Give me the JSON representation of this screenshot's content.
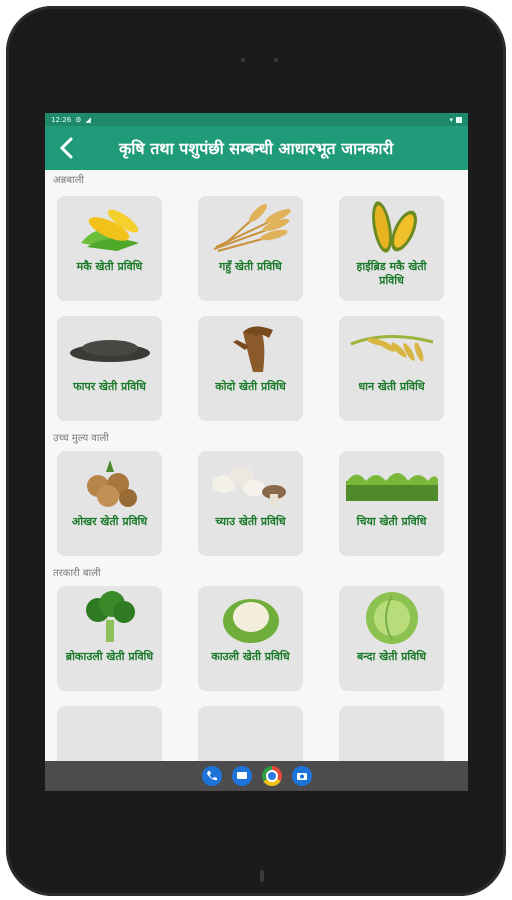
{
  "status": {
    "time": "12:26",
    "icons": [
      "settings-icon",
      "signal-icon",
      "wifi-icon",
      "battery-icon"
    ]
  },
  "header": {
    "back_icon": "‹",
    "title": "कृषि तथा पशुपंछी सम्बन्धी आधारभूत जानकारी"
  },
  "colors": {
    "appbar": "#1f9b7a",
    "label": "#1b7a2a",
    "card": "#e4e4e4"
  },
  "sections": [
    {
      "label": "अन्नबाली",
      "items": [
        {
          "label": "मकै खेती प्रविधि",
          "icon": "corn-icon"
        },
        {
          "label": "गहुँ खेती प्रविधि",
          "icon": "wheat-icon"
        },
        {
          "label": "हाईब्रिड मकै खेती प्रविधि",
          "icon": "hybrid-corn-icon"
        },
        {
          "label": "फापर खेती प्रविधि",
          "icon": "buckwheat-icon"
        },
        {
          "label": "कोदो खेती प्रविधि",
          "icon": "millet-icon"
        },
        {
          "label": "धान खेती प्रविधि",
          "icon": "rice-icon"
        }
      ]
    },
    {
      "label": "उच्च मुल्य वाली",
      "items": [
        {
          "label": "ओखर खेती प्रविधि",
          "icon": "walnut-icon"
        },
        {
          "label": "च्याउ खेती प्रविधि",
          "icon": "mushroom-icon"
        },
        {
          "label": "चिया खेती प्रविधि",
          "icon": "tea-icon"
        }
      ]
    },
    {
      "label": "तरकारी बाली",
      "items": [
        {
          "label": "ब्रोकाउली खेती प्रविधि",
          "icon": "broccoli-icon"
        },
        {
          "label": "काउली खेती प्रविधि",
          "icon": "cauliflower-icon"
        },
        {
          "label": "बन्दा खेती प्रविधि",
          "icon": "cabbage-icon"
        }
      ]
    }
  ],
  "navbar": {
    "icons": [
      "phone-icon",
      "messages-icon",
      "chrome-icon",
      "camera-icon"
    ]
  }
}
